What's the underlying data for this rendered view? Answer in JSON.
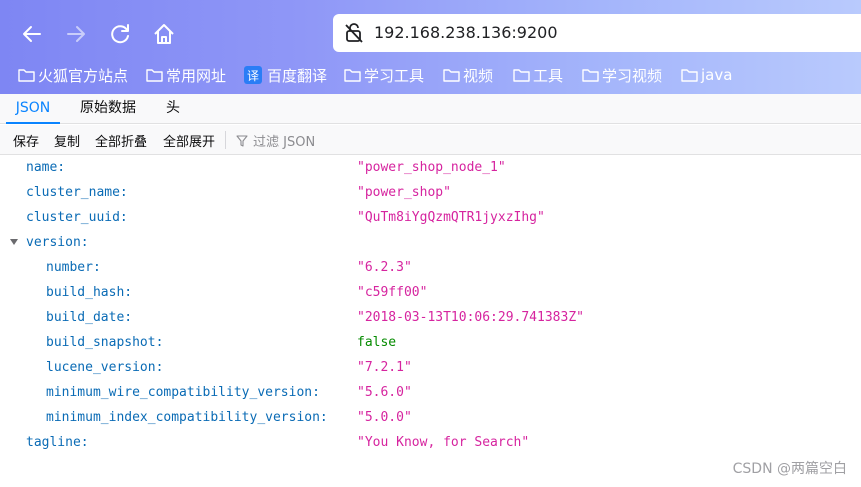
{
  "browser": {
    "url": "192.168.238.136:9200",
    "bookmarks": [
      {
        "label": "火狐官方站点",
        "icon": "folder-icon"
      },
      {
        "label": "常用网址",
        "icon": "folder-icon"
      },
      {
        "label": "百度翻译",
        "icon": "translate-icon",
        "badge": "译"
      },
      {
        "label": "学习工具",
        "icon": "folder-icon"
      },
      {
        "label": "视频",
        "icon": "folder-icon"
      },
      {
        "label": "工具",
        "icon": "folder-icon"
      },
      {
        "label": "学习视频",
        "icon": "folder-icon"
      },
      {
        "label": "java",
        "icon": "folder-icon"
      }
    ]
  },
  "viewer": {
    "tabs": [
      {
        "label": "JSON",
        "active": true
      },
      {
        "label": "原始数据",
        "active": false
      },
      {
        "label": "头",
        "active": false
      }
    ],
    "toolbar": {
      "save": "保存",
      "copy": "复制",
      "collapse_all": "全部折叠",
      "expand_all": "全部展开",
      "filter_placeholder": "过滤 JSON"
    },
    "rows": [
      {
        "key": "name:",
        "value": "\"power_shop_node_1\"",
        "type": "string",
        "depth": 0
      },
      {
        "key": "cluster_name:",
        "value": "\"power_shop\"",
        "type": "string",
        "depth": 0
      },
      {
        "key": "cluster_uuid:",
        "value": "\"QuTm8iYgQzmQTR1jyxzIhg\"",
        "type": "string",
        "depth": 0
      },
      {
        "key": "version:",
        "value": "",
        "type": "object",
        "depth": 0,
        "expanded": true
      },
      {
        "key": "number:",
        "value": "\"6.2.3\"",
        "type": "string",
        "depth": 1
      },
      {
        "key": "build_hash:",
        "value": "\"c59ff00\"",
        "type": "string",
        "depth": 1
      },
      {
        "key": "build_date:",
        "value": "\"2018-03-13T10:06:29.741383Z\"",
        "type": "string",
        "depth": 1
      },
      {
        "key": "build_snapshot:",
        "value": "false",
        "type": "boolean",
        "depth": 1
      },
      {
        "key": "lucene_version:",
        "value": "\"7.2.1\"",
        "type": "string",
        "depth": 1
      },
      {
        "key": "minimum_wire_compatibility_version:",
        "value": "\"5.6.0\"",
        "type": "string",
        "depth": 1
      },
      {
        "key": "minimum_index_compatibility_version:",
        "value": "\"5.0.0\"",
        "type": "string",
        "depth": 1
      },
      {
        "key": "tagline:",
        "value": "\"You Know, for Search\"",
        "type": "string",
        "depth": 0
      }
    ]
  },
  "watermark": "CSDN @两篇空白"
}
